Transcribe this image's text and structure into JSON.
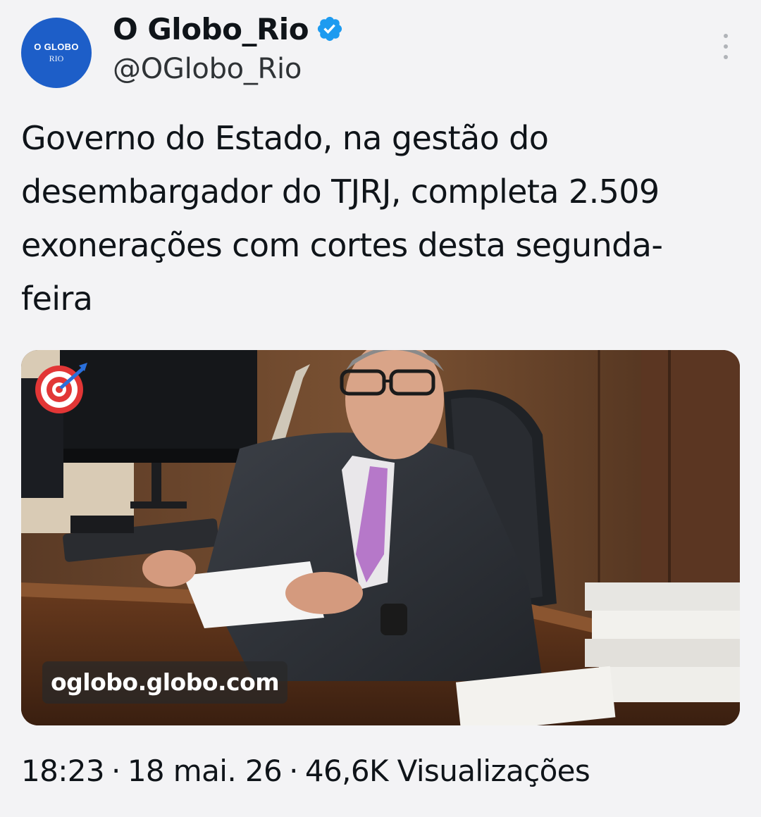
{
  "author": {
    "display_name": "O Globo_Rio",
    "handle": "@OGlobo_Rio",
    "avatar_brand": "O GLOBO",
    "avatar_sub": "RIO",
    "verified": true,
    "brand_color": "#1d5ec8",
    "verified_color": "#1d9bf0"
  },
  "tweet": {
    "text": "Governo do Estado, na gestão do desembargador do TJRJ, completa 2.509 exonerações com cortes desta segunda-feira"
  },
  "media": {
    "link_label": "oglobo.globo.com",
    "emoji_icon": "direct-hit-target-icon"
  },
  "meta": {
    "time": "18:23",
    "date": "18 mai. 26",
    "views": "46,6K Visualizações"
  },
  "icons": {
    "menu": "more-vertical-icon",
    "verified": "verified-badge-icon"
  }
}
